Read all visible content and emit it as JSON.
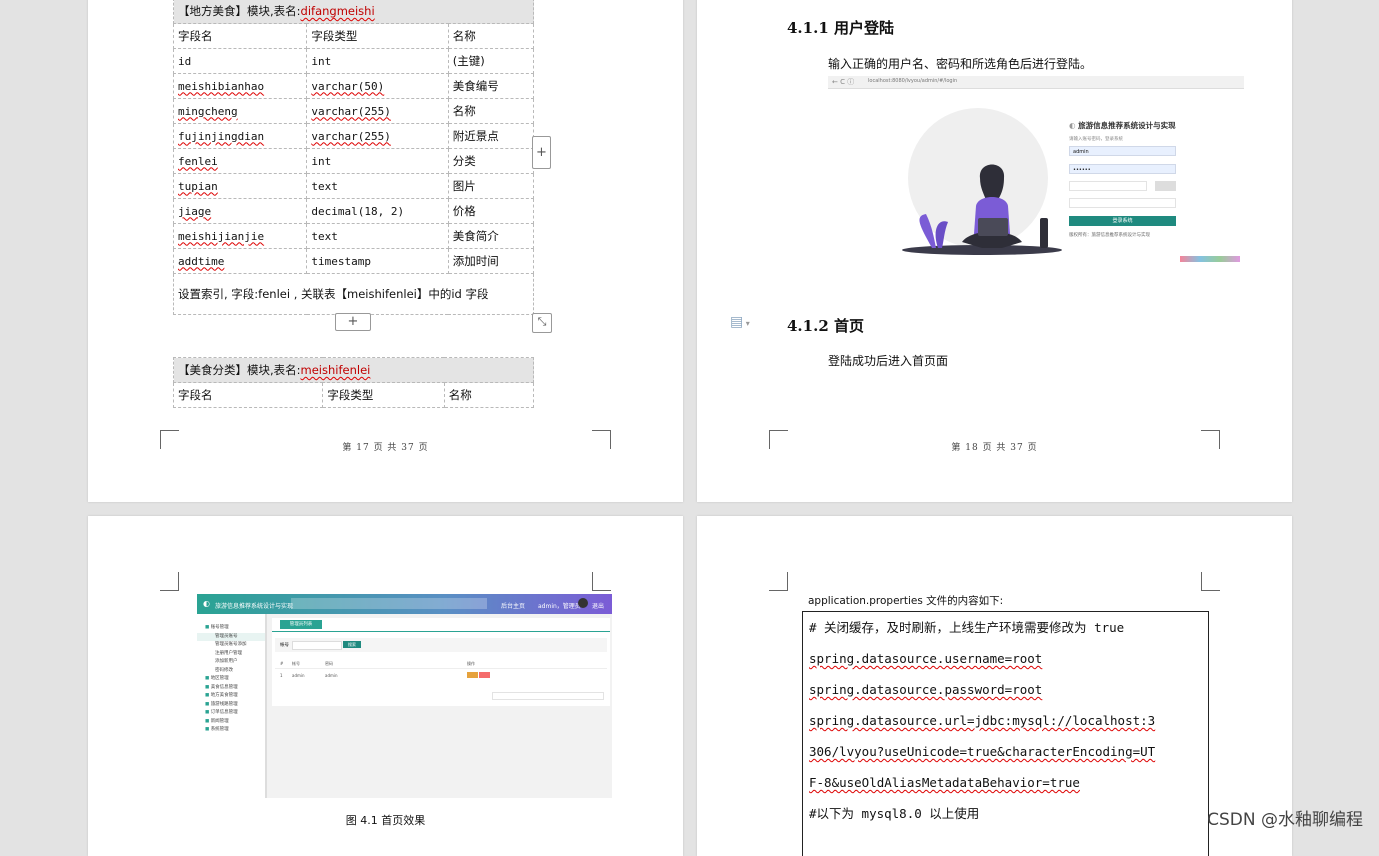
{
  "page17": {
    "table1_caption_prefix": "【地方美食】模块,表名:",
    "table1_name": "difangmeishi",
    "headers": [
      "字段名",
      "字段类型",
      "名称"
    ],
    "rows": [
      [
        "id",
        "int",
        "(主键)"
      ],
      [
        "meishibianhao",
        "varchar(50)",
        "美食编号"
      ],
      [
        "mingcheng",
        "varchar(255)",
        "名称"
      ],
      [
        "fujinjingdian",
        "varchar(255)",
        "附近景点"
      ],
      [
        "fenlei",
        "int",
        "分类"
      ],
      [
        "tupian",
        "text",
        "图片"
      ],
      [
        "jiage",
        "decimal(18, 2)",
        "价格"
      ],
      [
        "meishijianjie",
        "text",
        "美食简介"
      ],
      [
        "addtime",
        "timestamp",
        "添加时间"
      ]
    ],
    "index_note": "设置索引, 字段:fenlei , 关联表【meishifenlei】中的id 字段",
    "table2_caption_prefix": "【美食分类】模块,表名:",
    "table2_name": "meishifenlei",
    "table2_headers": [
      "字段名",
      "字段类型",
      "名称"
    ],
    "footer": "第 17 页 共 37 页",
    "add_col_glyph": "+",
    "add_row_glyph": "+",
    "resize_glyph": "⤡"
  },
  "page18": {
    "h1": "4.1.1 用户登陆",
    "p1": "输入正确的用户名、密码和所选角色后进行登陆。",
    "login_title": "旅游信息推荐系统设计与实现",
    "login_sub": "请输入账号密码，登录系统",
    "login_user": "admin",
    "login_pass": "••••••",
    "login_btn": "登录系统",
    "login_footer": "版权所有：旅游信息推荐系统设计与实现",
    "url": "localhost:8080/lvyou/admin/#/login",
    "h2": "4.1.2 首页",
    "p2": "登陆成功后进入首页面",
    "footer": "第 18 页 共 37 页"
  },
  "page19": {
    "app_title": "旅游信息推荐系统设计与实现",
    "nav_home": "后台主页",
    "nav_user": "admin，管理员",
    "nav_logout": "退出",
    "menu": [
      "账号管理",
      "管理员账号",
      "管理员账号添加",
      "注册用户管理",
      "添加新用户",
      "密码修改",
      "地区管理",
      "美食信息管理",
      "地方美食管理",
      "旅游线路管理",
      "订单信息管理",
      "新闻管理",
      "系统管理"
    ],
    "tab_label": "管理员列表",
    "search_label": "帐号",
    "search_btn": "搜索",
    "table_headers": [
      "#",
      "帐号",
      "密码",
      "操作"
    ],
    "table_row": [
      "1",
      "admin",
      "admin"
    ],
    "caption": "图 4.1 首页效果"
  },
  "page20": {
    "intro": "application.properties 文件的内容如下:",
    "lines": [
      "#       关闭缓存，及时刷新，上线生产环境需要修改为 true",
      "spring.datasource.username=root",
      "spring.datasource.password=root",
      "spring.datasource.url=jdbc:mysql://localhost:3",
      "306/lvyou?useUnicode=true&characterEncoding=UT",
      "F-8&useOldAliasMetadataBehavior=true",
      "#以下为 mysql8.0 以上使用"
    ]
  },
  "watermark": "CSDN @水釉聊编程",
  "colors": {
    "squiggle": "#d00000",
    "teal": "#1f8a7f",
    "purple": "#7b5cd6"
  }
}
